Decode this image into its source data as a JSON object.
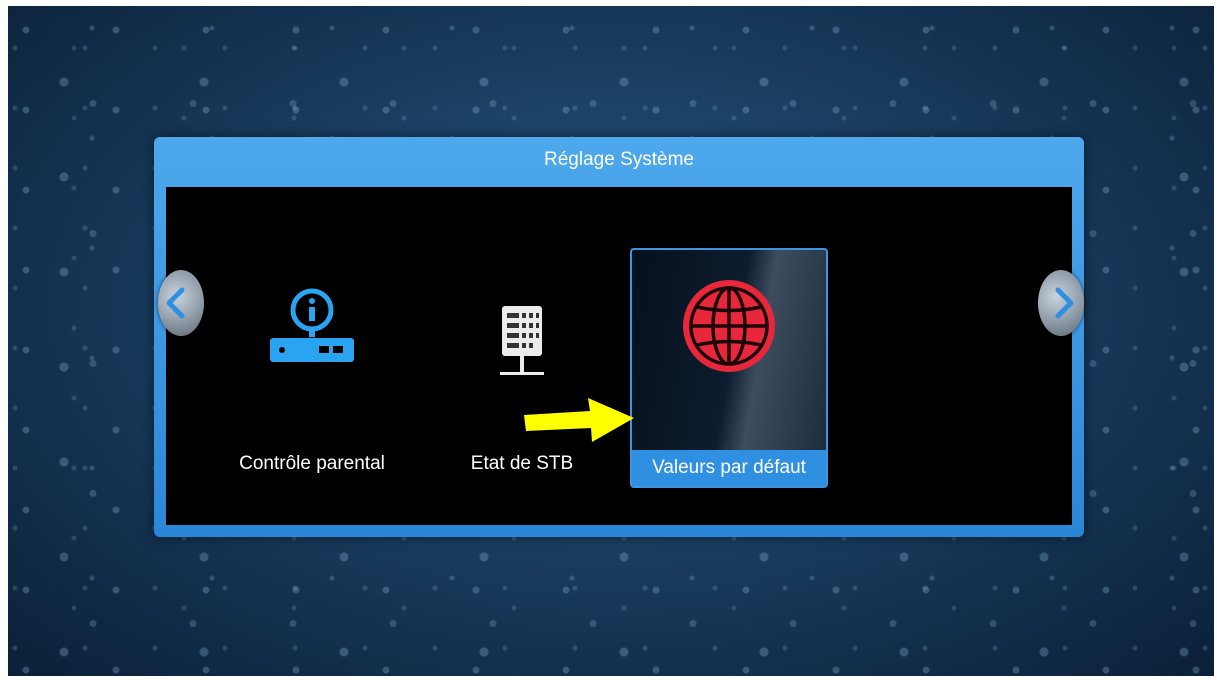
{
  "dialog": {
    "title": "Réglage Système"
  },
  "menu": {
    "items": [
      {
        "label": "Contrôle parental",
        "icon": "info-receiver-icon",
        "selected": false
      },
      {
        "label": "Etat de STB",
        "icon": "stb-status-icon",
        "selected": false
      },
      {
        "label": "Valeurs par défaut",
        "icon": "globe-icon",
        "selected": true
      }
    ]
  },
  "navigation": {
    "left_icon": "chevron-left-icon",
    "right_icon": "chevron-right-icon"
  },
  "annotation": {
    "icon": "yellow-arrow-icon",
    "color": "#ffff00"
  },
  "colors": {
    "dialog_frame": "#3a97e6",
    "selection": "#2f90e2",
    "icon_blue": "#2aa3f0",
    "globe_red": "#e8283a"
  }
}
